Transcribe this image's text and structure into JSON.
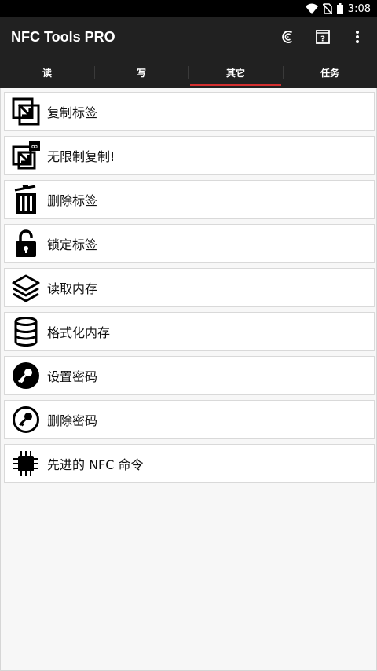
{
  "status_bar": {
    "time": "3:08"
  },
  "app_bar": {
    "title": "NFC Tools PRO",
    "actions": [
      "nfc-c-icon",
      "help-icon",
      "more-vert-icon"
    ]
  },
  "tabs": [
    {
      "label": "读"
    },
    {
      "label": "写"
    },
    {
      "label": "其它",
      "active": true
    },
    {
      "label": "任务"
    }
  ],
  "menu": [
    {
      "label": "复制标签",
      "icon": "copy-tag-icon"
    },
    {
      "label": "无限制复制!",
      "icon": "unlimited-copy-icon"
    },
    {
      "label": "删除标签",
      "icon": "trash-icon"
    },
    {
      "label": "锁定标签",
      "icon": "lock-icon"
    },
    {
      "label": "读取内存",
      "icon": "layers-icon"
    },
    {
      "label": "格式化内存",
      "icon": "database-icon"
    },
    {
      "label": "设置密码",
      "icon": "key-icon"
    },
    {
      "label": "删除密码",
      "icon": "key-remove-icon"
    },
    {
      "label": "先进的 NFC 命令",
      "icon": "chip-icon"
    }
  ],
  "colors": {
    "app_bar": "#212121",
    "tab_indicator": "#d32f2f",
    "background": "#f5f5f5"
  }
}
